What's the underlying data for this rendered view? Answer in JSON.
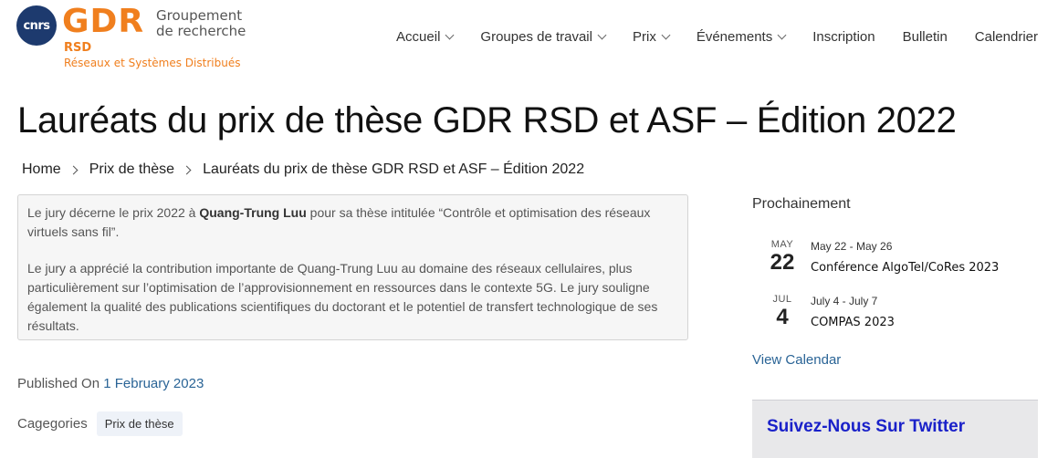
{
  "brand": {
    "cnrs": "cnrs",
    "gdr": "GDR",
    "gdr_line1": "Groupement",
    "gdr_line2": "de recherche",
    "rsd": "RSD",
    "rsd_full": "Réseaux et Systèmes Distribués",
    "colors": {
      "orange": "#f07f1e",
      "navy": "#1d3a6e"
    }
  },
  "nav": {
    "items": [
      {
        "label": "Accueil",
        "dropdown": true
      },
      {
        "label": "Groupes de travail",
        "dropdown": true
      },
      {
        "label": "Prix",
        "dropdown": true
      },
      {
        "label": "Événements",
        "dropdown": true
      },
      {
        "label": "Inscription",
        "dropdown": false
      },
      {
        "label": "Bulletin",
        "dropdown": false
      },
      {
        "label": "Calendrier",
        "dropdown": false
      }
    ]
  },
  "page": {
    "title": "Lauréats du prix de thèse GDR RSD et ASF – Édition 2022"
  },
  "breadcrumb": {
    "items": [
      "Home",
      "Prix de thèse",
      "Lauréats du prix de thèse GDR RSD et ASF – Édition 2022"
    ]
  },
  "content": {
    "p1_before": "Le jury décerne le prix 2022 à ",
    "p1_name": "Quang-Trung Luu",
    "p1_after": " pour sa thèse intitulée “Contrôle et optimisation des réseaux virtuels sans fil”.",
    "p2": "Le jury a apprécié la  contribution importante de Quang-Trung Luu au domaine des réseaux  cellulaires, plus particulièrement sur l’optimisation de  l’approvisionnement en ressources dans le  contexte 5G. Le jury souligne également la qualité des publications  scientifiques du doctorant et le potentiel de transfert technologique de  ses résultats."
  },
  "meta": {
    "published_label": "Published On",
    "published_date": "1 February 2023",
    "categories_label": "Cagegories",
    "category": "Prix de thèse"
  },
  "sidebar": {
    "heading": "Prochainement",
    "events": [
      {
        "month": "MAY",
        "day": "22",
        "range": "May 22 - May 26",
        "title": "Conférence AlgoTel/CoRes 2023"
      },
      {
        "month": "JUL",
        "day": "4",
        "range": "July 4 - July 7",
        "title": "COMPAS 2023"
      }
    ],
    "view_calendar": "View Calendar",
    "twitter_title": "Suivez-Nous Sur Twitter"
  }
}
